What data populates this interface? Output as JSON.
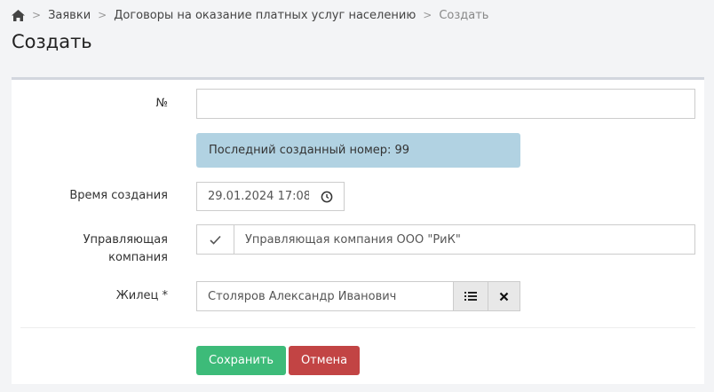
{
  "breadcrumb": {
    "home_icon": "home-icon",
    "items": [
      "Заявки",
      "Договоры на оказание платных услуг населению",
      "Создать"
    ],
    "separator": ">"
  },
  "page": {
    "title": "Создать"
  },
  "form": {
    "number": {
      "label": "№",
      "value": ""
    },
    "info": "Последний созданный номер: 99",
    "created_time": {
      "label": "Время создания",
      "value": "29.01.2024 17:08",
      "icon": "clock-icon"
    },
    "company": {
      "label_line1": "Управляющая",
      "label_line2": "компания",
      "value": "Управляющая компания ООО \"РиК\"",
      "icon": "check-icon"
    },
    "resident": {
      "label": "Жилец *",
      "value": "Столяров Александр Иванович",
      "list_icon": "list-icon",
      "clear_icon": "close-icon"
    }
  },
  "actions": {
    "save": "Сохранить",
    "cancel": "Отмена"
  },
  "colors": {
    "save": "#3dbb79",
    "cancel": "#c24444",
    "info_bg": "#b1d2e2"
  }
}
